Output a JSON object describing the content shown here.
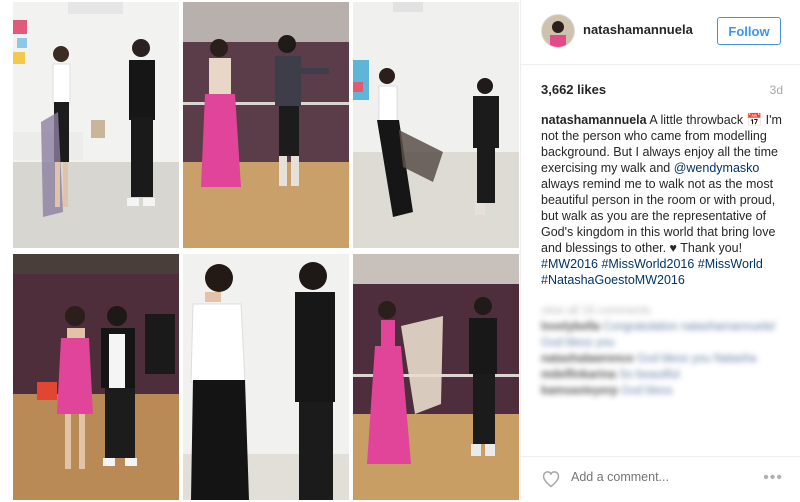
{
  "post": {
    "username": "natashamannuela",
    "follow_label": "Follow",
    "likes": "3,662 likes",
    "time": "3d",
    "caption_user": "natashamannuela",
    "caption_text": " A little throwback 📅 I'm not the person who came from modelling background. But I always enjoy all the time exercising my walk and ",
    "caption_mention": "@wendymasko",
    "caption_text2": " always remind me to walk not as the most beautiful person in the room or with proud, but walk as you are the representative of God's kingdom in this world that bring love and blessings to other. ♥ Thank you! ",
    "hashtags": "#MW2016 #MissWorld2016 #MissWorld #NatashaGoestoMW2016"
  },
  "comments": {
    "load_more": "view all 16 comments",
    "items": [
      {
        "user": "lovelybella",
        "text": "Congratulation natashamannuela! God bless you"
      },
      {
        "user": "natashalawrence",
        "text": "God bless you Natasha"
      },
      {
        "user": "mdelfinkarina",
        "text": "So beautiful"
      },
      {
        "user": "kamsasteyerp",
        "text": "God bless"
      }
    ]
  },
  "footer": {
    "comment_placeholder": "Add a comment...",
    "more_label": "•••"
  },
  "icons": {
    "heart": "heart-icon",
    "more": "more-options-icon"
  },
  "colors": {
    "follow_blue": "#3897f0",
    "hashtag_blue": "#003569",
    "muted_gray": "#a5a7aa",
    "dress_pink": "#e0459a"
  }
}
